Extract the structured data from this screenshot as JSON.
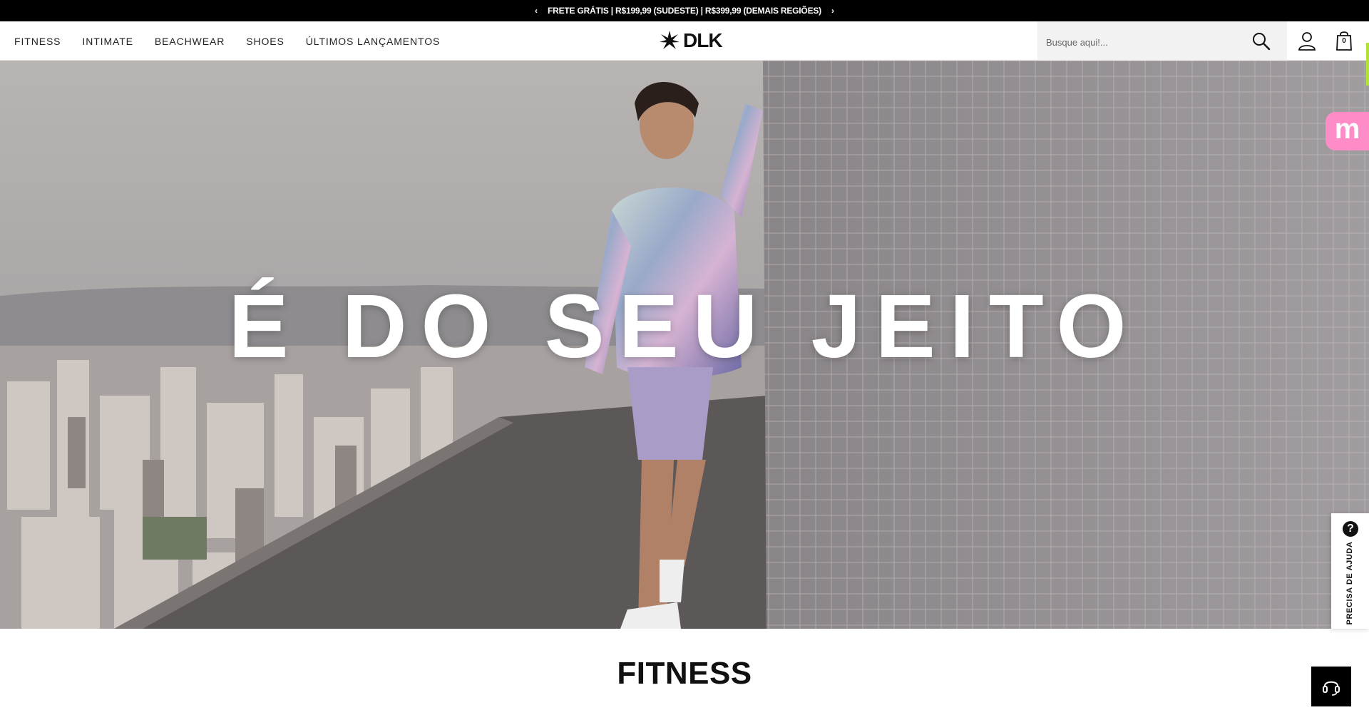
{
  "promo": {
    "text": "FRETE GRÁTIS | R$199,99 (SUDESTE) | R$399,99 (DEMAIS REGIÕES)",
    "prev_arrow": "‹",
    "next_arrow": "›"
  },
  "nav": {
    "items": [
      {
        "label": "FITNESS"
      },
      {
        "label": "INTIMATE"
      },
      {
        "label": "BEACHWEAR"
      },
      {
        "label": "SHOES"
      },
      {
        "label": "ÚLTIMOS LANÇAMENTOS"
      }
    ]
  },
  "logo": {
    "text": "DLK",
    "icon": "dlk-star-icon"
  },
  "search": {
    "placeholder": "Busque aqui!...",
    "value": "",
    "icon": "search-icon"
  },
  "account": {
    "icon": "user-icon"
  },
  "cart": {
    "icon": "bag-icon",
    "count": "0"
  },
  "hero": {
    "title": "É DO SEU JEITO"
  },
  "section": {
    "title": "FITNESS"
  },
  "widgets": {
    "m_badge_letter": "m",
    "m_badge_color": "#ff8cc6",
    "help_label": "PRECISA DE AJUDA",
    "help_icon_glyph": "?",
    "support_icon": "headset-icon",
    "scroll_accent": "#b3e234"
  }
}
